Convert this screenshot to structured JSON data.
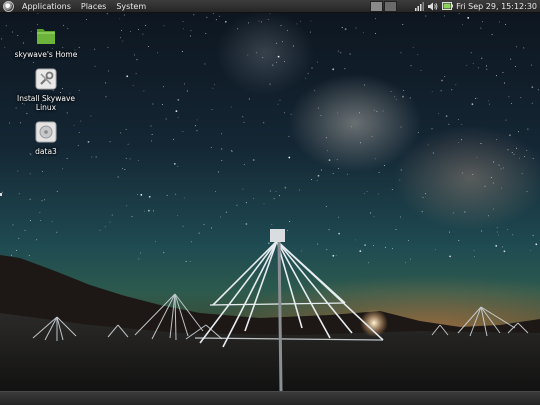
{
  "top_panel": {
    "menus": [
      "Applications",
      "Places",
      "System"
    ],
    "clock": "Fri Sep 29, 15:12:30",
    "tray_icons": [
      "network-signal-icon",
      "volume-icon",
      "battery-icon"
    ],
    "workspaces": 2
  },
  "desktop": {
    "icons": [
      {
        "name": "home-folder-icon",
        "label": "skywave's Home"
      },
      {
        "name": "installer-icon",
        "label": "Install Skywave Linux"
      },
      {
        "name": "disk-drive-icon",
        "label": "data3"
      }
    ],
    "wallpaper": "night sky with milky way over radio antenna array"
  },
  "colors": {
    "panel_bg": "#2e2e2e",
    "folder_green": "#6bb33a",
    "battery_green": "#8bd35a"
  }
}
